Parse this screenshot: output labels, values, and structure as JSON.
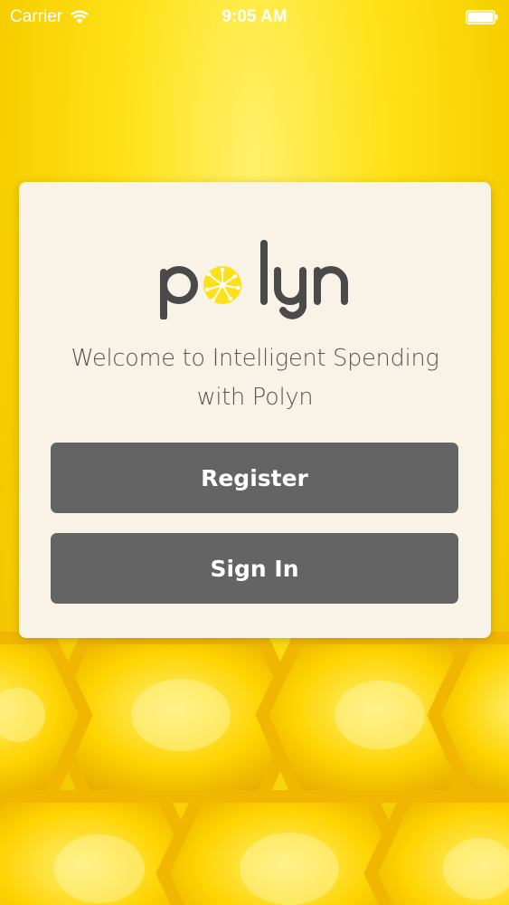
{
  "status_bar": {
    "carrier": "Carrier",
    "time": "9:05 AM",
    "wifi_icon": "wifi-icon",
    "battery_icon": "battery-icon"
  },
  "app": {
    "logo_text": "polyn",
    "logo_icon": "pollen-icon",
    "welcome_line1": "Welcome to Intelligent Spending",
    "welcome_line2": "with Polyn"
  },
  "actions": {
    "register_label": "Register",
    "signin_label": "Sign In"
  },
  "colors": {
    "background": "#f7cf00",
    "card": "#f8f3e6",
    "button": "#646464",
    "logo_text": "#4a4a4a",
    "logo_accent": "#ffe01a"
  }
}
